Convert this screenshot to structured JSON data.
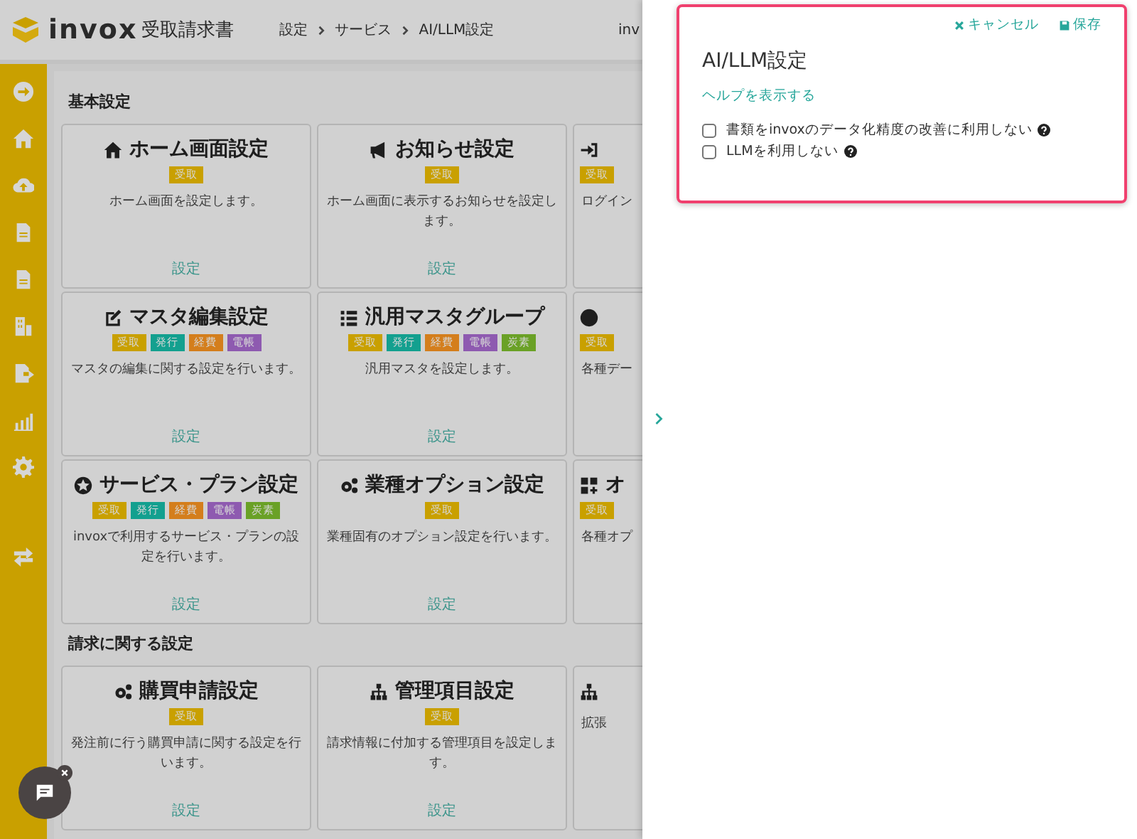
{
  "header": {
    "logo_text": "invox",
    "product": "受取請求書",
    "breadcrumbs": [
      "設定",
      "サービス",
      "AI/LLM設定"
    ],
    "user": "inv"
  },
  "sections": [
    {
      "title": "基本設定",
      "cards": [
        {
          "kind": "full",
          "title": "ホーム画面設定",
          "tags": [
            {
              "label": "受取",
              "color": "#c9a000"
            }
          ],
          "description": "ホーム画面を設定します。",
          "link": "設定"
        },
        {
          "kind": "full",
          "title": "お知らせ設定",
          "tags": [
            {
              "label": "受取",
              "color": "#c9a000"
            }
          ],
          "description": "ホーム画面に表示するお知らせを設定します。",
          "link": "設定"
        },
        {
          "kind": "clipped",
          "tags": [
            {
              "label": "受取",
              "color": "#c9a000"
            }
          ],
          "description": "ログイン"
        },
        {
          "kind": "full",
          "title": "マスタ編集設定",
          "tags": [
            {
              "label": "受取",
              "color": "#c9a000"
            },
            {
              "label": "発行",
              "color": "#13a08f"
            },
            {
              "label": "経費",
              "color": "#d47e1c"
            },
            {
              "label": "電帳",
              "color": "#8e5ab0"
            }
          ],
          "description": "マスタの編集に関する設定を行います。",
          "link": "設定"
        },
        {
          "kind": "full",
          "title": "汎用マスタグループ",
          "tags": [
            {
              "label": "受取",
              "color": "#c9a000"
            },
            {
              "label": "発行",
              "color": "#13a08f"
            },
            {
              "label": "経費",
              "color": "#d47e1c"
            },
            {
              "label": "電帳",
              "color": "#8e5ab0"
            },
            {
              "label": "炭素",
              "color": "#6aa126"
            }
          ],
          "description": "汎用マスタを設定します。",
          "link": "設定"
        },
        {
          "kind": "clipped",
          "tags": [
            {
              "label": "受取",
              "color": "#c9a000"
            }
          ],
          "description": "各種デー"
        },
        {
          "kind": "full",
          "title": "サービス・プラン設定",
          "tags": [
            {
              "label": "受取",
              "color": "#c9a000"
            },
            {
              "label": "発行",
              "color": "#13a08f"
            },
            {
              "label": "経費",
              "color": "#d47e1c"
            },
            {
              "label": "電帳",
              "color": "#8e5ab0"
            },
            {
              "label": "炭素",
              "color": "#6aa126"
            }
          ],
          "description": "invoxで利用するサービス・プランの設定を行います。",
          "link": "設定"
        },
        {
          "kind": "full",
          "title": "業種オプション設定",
          "tags": [
            {
              "label": "受取",
              "color": "#c9a000"
            }
          ],
          "description": "業種固有のオプション設定を行います。",
          "link": "設定"
        },
        {
          "kind": "clipped",
          "title": "オ",
          "tags": [
            {
              "label": "受取",
              "color": "#c9a000"
            }
          ],
          "description": "各種オプ"
        }
      ]
    },
    {
      "title": "請求に関する設定",
      "cards": [
        {
          "kind": "full",
          "title": "購買申請設定",
          "tags": [
            {
              "label": "受取",
              "color": "#c9a000"
            }
          ],
          "description": "発注前に行う購買申請に関する設定を行います。",
          "link": "設定"
        },
        {
          "kind": "full",
          "title": "管理項目設定",
          "tags": [
            {
              "label": "受取",
              "color": "#c9a000"
            }
          ],
          "description": "請求情報に付加する管理項目を設定します。",
          "link": "設定"
        },
        {
          "kind": "clipped",
          "description": "拡張"
        }
      ]
    }
  ],
  "panel": {
    "cancel": "キャンセル",
    "save": "保存",
    "title": "AI/LLM設定",
    "help_link": "ヘルプを表示する",
    "options": [
      {
        "label": "書類をinvoxのデータ化精度の改善に利用しない",
        "checked": false
      },
      {
        "label": "LLMを利用しない",
        "checked": false
      }
    ]
  }
}
